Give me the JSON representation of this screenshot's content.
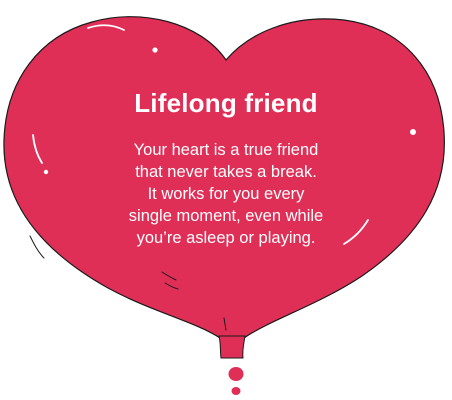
{
  "card": {
    "title": "Lifelong friend",
    "body_lines": [
      "Your heart is a true friend",
      "that never takes a break.",
      "It works for you every",
      "single moment, even while",
      "you’re asleep or playing."
    ]
  },
  "colors": {
    "heart_fill": "#E02F57",
    "outline": "#1A1A1A",
    "text": "#FFFFFF"
  }
}
